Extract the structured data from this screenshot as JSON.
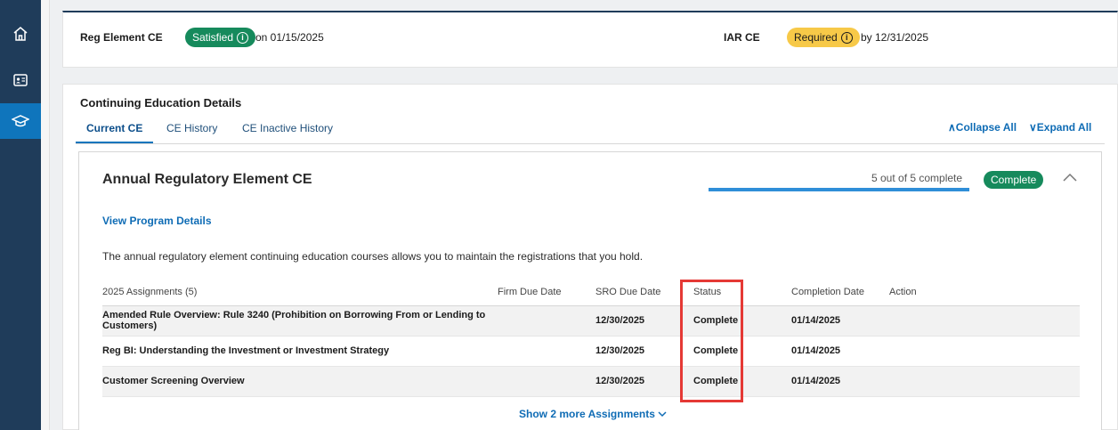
{
  "sidebar": {
    "items": [
      {
        "icon": "home-icon"
      },
      {
        "icon": "id-card-icon"
      },
      {
        "icon": "graduation-cap-icon",
        "active": true
      }
    ]
  },
  "summary": {
    "reg": {
      "label": "Reg Element CE",
      "status": "Satisfied",
      "date": "on 01/15/2025"
    },
    "iar": {
      "label": "IAR CE",
      "status": "Required",
      "date": "by 12/31/2025"
    }
  },
  "details": {
    "title": "Continuing Education Details",
    "tabs": [
      "Current CE",
      "CE History",
      "CE Inactive History"
    ],
    "collapse_all": "Collapse All",
    "expand_all": "Expand All"
  },
  "card": {
    "title": "Annual Regulatory Element CE",
    "progress_text": "5 out of 5 complete",
    "progress_fraction": 1.0,
    "badge": "Complete",
    "view_link": "View Program Details",
    "description": "The annual regulatory element continuing education courses allows you to maintain the registrations that you hold."
  },
  "table": {
    "headers": [
      "2025 Assignments (5)",
      "Firm Due Date",
      "SRO Due Date",
      "Status",
      "Completion Date",
      "Action"
    ],
    "rows": [
      [
        "Amended Rule Overview: Rule 3240 (Prohibition on Borrowing From or Lending to Customers)",
        "",
        "12/30/2025",
        "Complete",
        "01/14/2025",
        ""
      ],
      [
        "Reg BI: Understanding the Investment or Investment Strategy",
        "",
        "12/30/2025",
        "Complete",
        "01/14/2025",
        ""
      ],
      [
        "Customer Screening Overview",
        "",
        "12/30/2025",
        "Complete",
        "01/14/2025",
        ""
      ]
    ]
  },
  "show_more": "Show 2 more Assignments",
  "colors": {
    "accent": "#0f75bc",
    "success": "#168a5c",
    "warning": "#f7c948",
    "highlight": "#e53935"
  }
}
